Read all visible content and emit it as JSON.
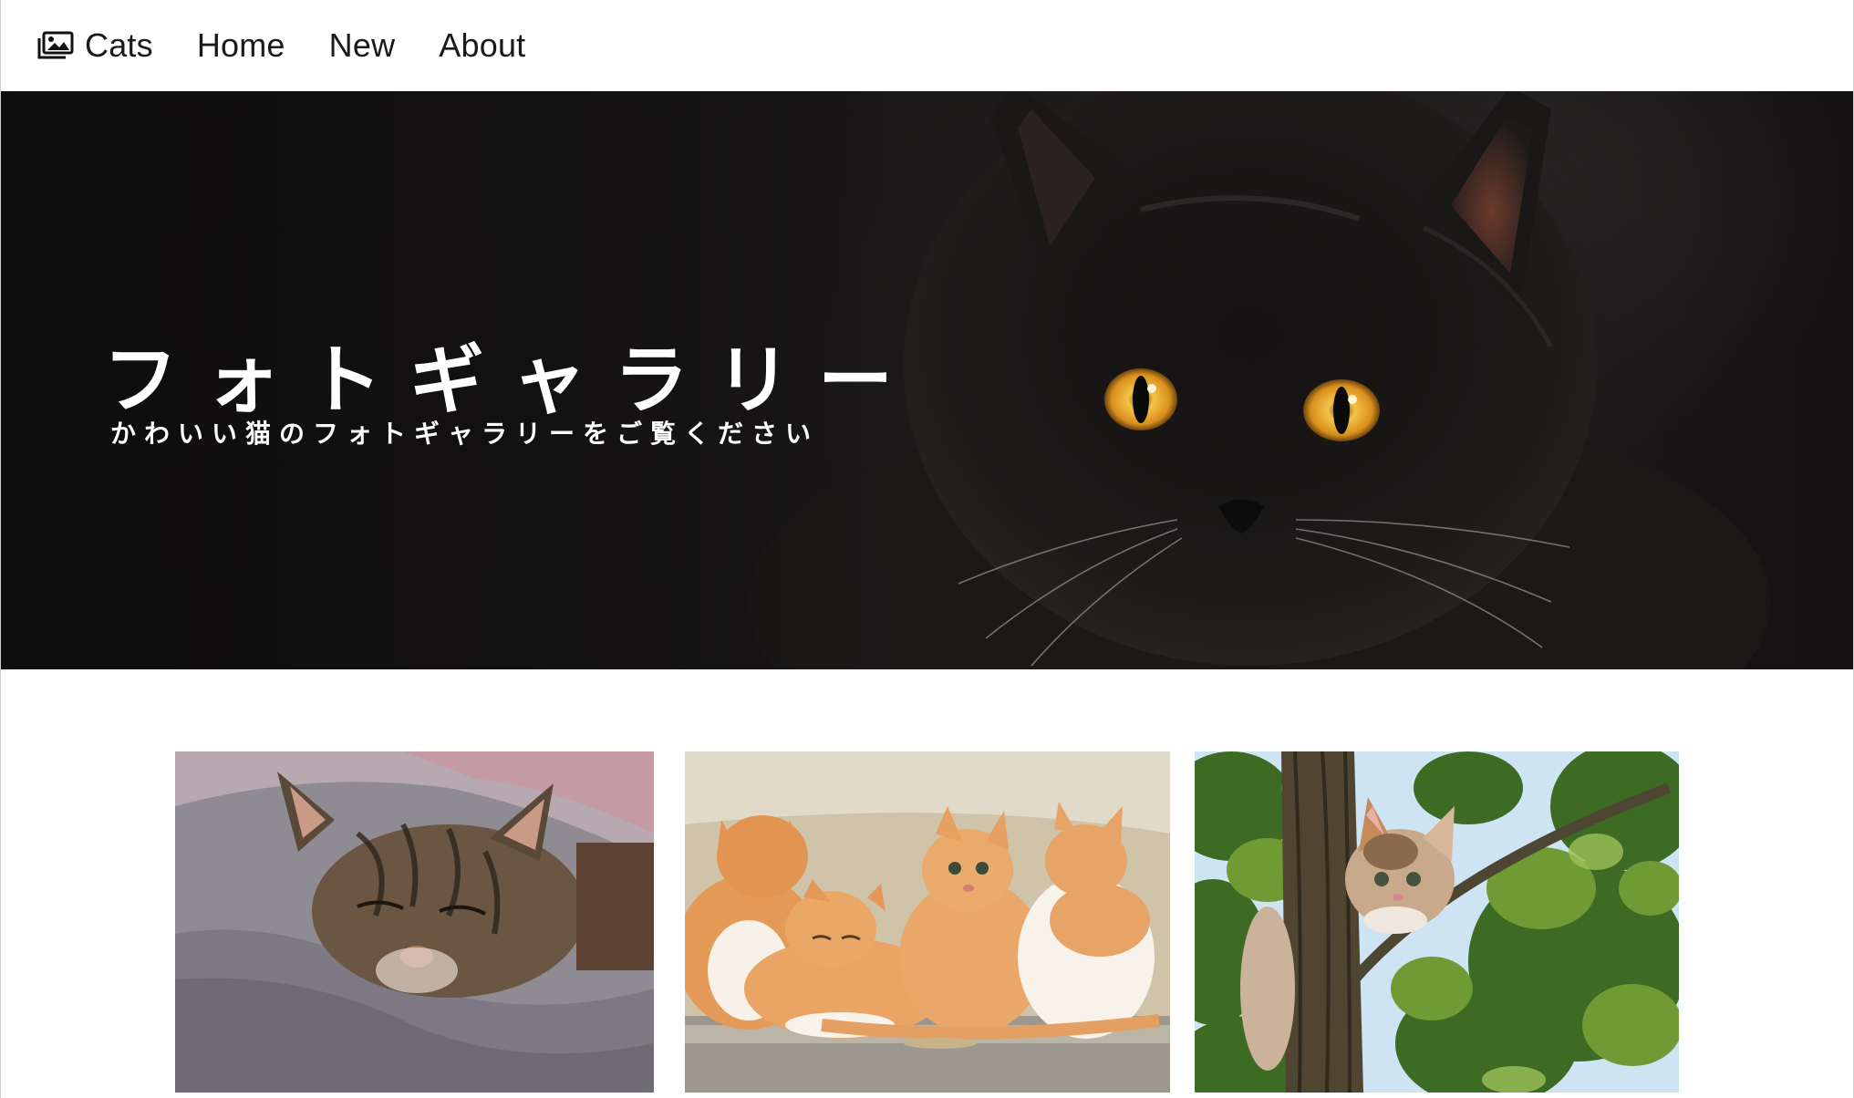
{
  "navbar": {
    "brand_label": "Cats",
    "brand_icon": "images-icon",
    "links": [
      {
        "label": "Home"
      },
      {
        "label": "New"
      },
      {
        "label": "About"
      }
    ]
  },
  "hero": {
    "title": "フォトギャラリー",
    "subtitle": "かわいい猫のフォトギャラリーをご覧ください",
    "image": "black-cat-photo"
  },
  "gallery": {
    "items": [
      {
        "image": "sleeping-tabby-cat-photo"
      },
      {
        "image": "orange-kittens-photo"
      },
      {
        "image": "kitten-in-tree-photo"
      }
    ]
  },
  "colors": {
    "nav_text": "#1a1a1a",
    "hero_bg": "#151313",
    "hero_text": "#ffffff",
    "cat_eye": "#e3a52c"
  }
}
